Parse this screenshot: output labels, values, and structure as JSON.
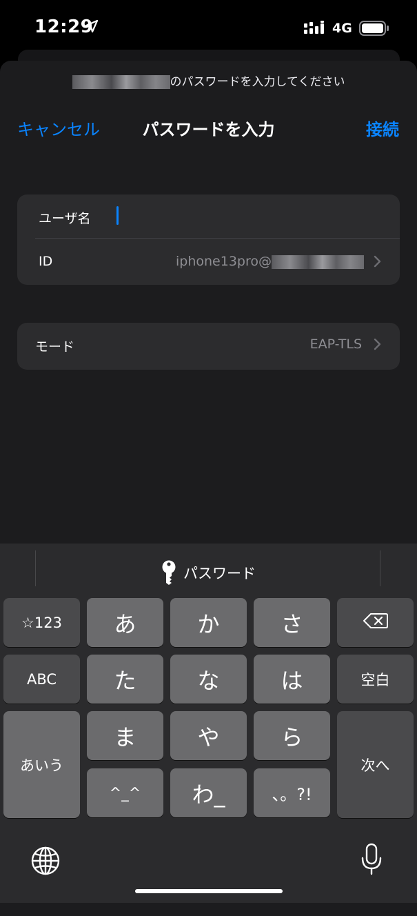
{
  "status_bar": {
    "time": "12:29",
    "network": "4G"
  },
  "sheet": {
    "prompt_suffix": "のパスワードを入力してください",
    "nav": {
      "cancel": "キャンセル",
      "title": "パスワードを入力",
      "connect": "接続"
    },
    "credentials": {
      "username_label": "ユーザ名",
      "username_value": "",
      "id_label": "ID",
      "id_value": "iphone13pro@"
    },
    "mode": {
      "label": "モード",
      "value": "EAP-TLS"
    }
  },
  "keyboard": {
    "quicktype": "パスワード",
    "keys": {
      "symbols": "☆123",
      "a": "あ",
      "ka": "か",
      "sa": "さ",
      "abc": "ABC",
      "ta": "た",
      "na": "な",
      "ha": "は",
      "space": "空白",
      "mode": "あいう",
      "ma": "ま",
      "ya": "や",
      "ra": "ら",
      "next": "次へ",
      "emoticon": "^_^",
      "wa": "わ_",
      "punct": "、。?!"
    }
  },
  "colors": {
    "accent": "#0a84ff",
    "sheet_bg": "#1c1c1e",
    "cell_bg": "#2c2c2e"
  }
}
